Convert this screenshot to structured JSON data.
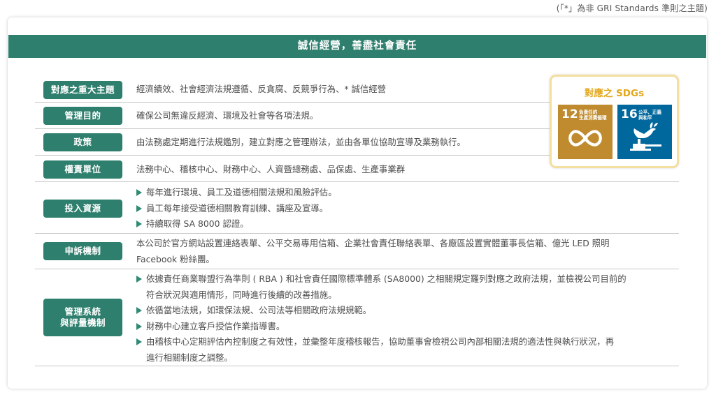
{
  "note": "(「*」為非 GRI Standards 準則之主題)",
  "title": "誠信經營，善盡社會責任",
  "rows": [
    {
      "label": "對應之重大主題",
      "text": "經濟績效、社會經濟法規遵循、反貪腐、反競爭行為、* 誠信經營"
    },
    {
      "label": "管理目的",
      "text": "確保公司無違反經濟、環境及社會等各項法規。"
    },
    {
      "label": "政策",
      "text": "由法務處定期進行法規鑑別，建立對應之管理辦法，並由各單位協助宣導及業務執行。"
    },
    {
      "label": "權責單位",
      "text": "法務中心、稽核中心、財務中心、人資暨總務處、品保處、生產事業群"
    },
    {
      "label": "投入資源",
      "bullets": [
        "每年進行環境、員工及道德相關法規和風險評估。",
        "員工每年接受道德相關教育訓練、講座及宣導。",
        "持續取得 SA 8000 認證。"
      ]
    },
    {
      "label": "申訴機制",
      "lines": [
        "本公司於官方網站設置連絡表單、公平交易專用信箱、企業社會責任聯絡表單、各廠區設置實體董事長信箱、億光 LED 照明",
        "Facebook 粉絲團。"
      ]
    },
    {
      "label_line1": "管理系統",
      "label_line2": "與評量機制",
      "bullets": [
        [
          "依據責任商業聯盟行為準則 ( RBA ) 和社會責任國際標準體系 (SA8000) 之相關規定羅列對應之政府法規，並檢視公司目前的",
          "符合狀況與適用情形，同時進行後續的改善措施。"
        ],
        [
          "依循當地法規，如環保法規、公司法等相關政府法規規範。"
        ],
        [
          "財務中心建立客戶授信作業指導書。"
        ],
        [
          "由稽核中心定期評估內控制度之有效性，並彙整年度稽核報告，協助董事會檢視公司內部相關法規的適法性與執行狀況，再",
          "進行相關制度之調整。"
        ]
      ]
    }
  ],
  "sdg": {
    "title": "對應之 SDGs",
    "goals": [
      {
        "number": "12",
        "label_line1": "負責任的",
        "label_line2": "生產消費循環",
        "color": "#bf8b2e",
        "icon": "infinity-loop-icon"
      },
      {
        "number": "16",
        "label_line1": "公平、正義",
        "label_line2": "與和平",
        "color": "#00689d",
        "icon": "dove-gavel-icon"
      }
    ]
  },
  "colors": {
    "accent": "#2f7f6e",
    "sdg_title": "#e3a81c",
    "sdg_border": "#f3dfa0"
  }
}
